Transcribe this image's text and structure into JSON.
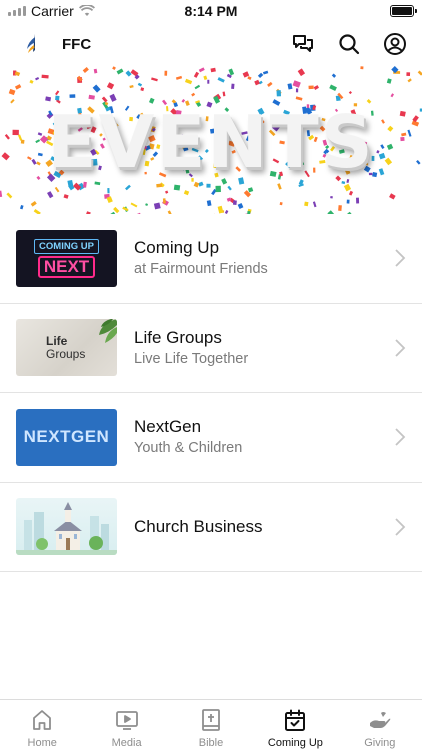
{
  "status_bar": {
    "carrier": "Carrier",
    "time": "8:14 PM"
  },
  "header": {
    "title": "FFC",
    "icons": [
      "chat-icon",
      "search-icon",
      "profile-icon"
    ]
  },
  "banner": {
    "text": "EVENTS"
  },
  "events": [
    {
      "title": "Coming Up",
      "subtitle": "at Fairmount Friends",
      "thumb_text": [
        "COMING UP",
        "NEXT"
      ]
    },
    {
      "title": "Life Groups",
      "subtitle": "Live Life Together",
      "thumb_text": [
        "Life",
        "Groups"
      ]
    },
    {
      "title": "NextGen",
      "subtitle": "Youth & Children",
      "thumb_text": [
        "NEXTGEN"
      ]
    },
    {
      "title": "Church Business",
      "subtitle": "",
      "thumb_text": []
    }
  ],
  "tabs": [
    {
      "label": "Home",
      "icon": "home-icon",
      "active": false
    },
    {
      "label": "Media",
      "icon": "media-icon",
      "active": false
    },
    {
      "label": "Bible",
      "icon": "bible-icon",
      "active": false
    },
    {
      "label": "Coming Up",
      "icon": "calendar-icon",
      "active": true
    },
    {
      "label": "Giving",
      "icon": "giving-icon",
      "active": false
    }
  ],
  "colors": {
    "accent": "#111111",
    "inactive": "#8e8e8e",
    "divider": "#e3e3e3",
    "nextgen_blue": "#2a6fc0"
  }
}
